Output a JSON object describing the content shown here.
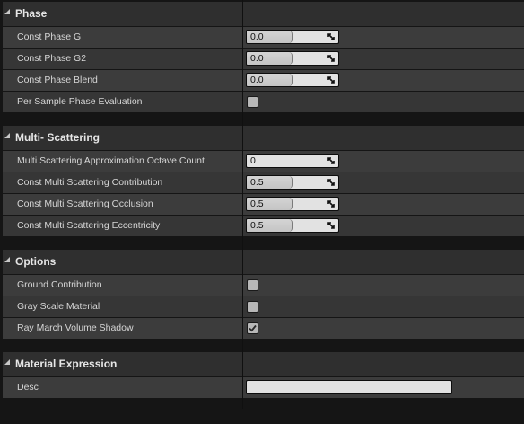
{
  "categories": {
    "phase": {
      "title": "Phase",
      "rows": {
        "const_phase_g": {
          "label": "Const Phase G",
          "value": "0.0"
        },
        "const_phase_g2": {
          "label": "Const Phase G2",
          "value": "0.0"
        },
        "const_phase_blend": {
          "label": "Const Phase Blend",
          "value": "0.0"
        },
        "per_sample_phase_evaluation": {
          "label": "Per Sample Phase Evaluation",
          "checked": false
        }
      }
    },
    "multi_scattering": {
      "title": "Multi- Scattering",
      "rows": {
        "octave_count": {
          "label": "Multi Scattering Approximation Octave Count",
          "value": "0"
        },
        "contribution": {
          "label": "Const Multi Scattering Contribution",
          "value": "0.5"
        },
        "occlusion": {
          "label": "Const Multi Scattering Occlusion",
          "value": "0.5"
        },
        "eccentricity": {
          "label": "Const Multi Scattering Eccentricity",
          "value": "0.5"
        }
      }
    },
    "options": {
      "title": "Options",
      "rows": {
        "ground_contribution": {
          "label": "Ground Contribution",
          "checked": false
        },
        "gray_scale_material": {
          "label": "Gray Scale Material",
          "checked": false
        },
        "ray_march_volume_shadow": {
          "label": "Ray March Volume Shadow",
          "checked": true
        }
      }
    },
    "material_expression": {
      "title": "Material Expression",
      "rows": {
        "desc": {
          "label": "Desc",
          "value": ""
        }
      }
    }
  },
  "icons": {
    "collapse": "triangle-collapse-icon",
    "spin_grip": "diagonal-resize-icon",
    "check": "checkmark-icon"
  },
  "colors": {
    "background": "#151515",
    "category_header": "#2f2f2f",
    "row_odd": "#3c3c3c",
    "row_even": "#363636",
    "field": "#e2e2e2",
    "label_text": "#d6d6d6"
  }
}
